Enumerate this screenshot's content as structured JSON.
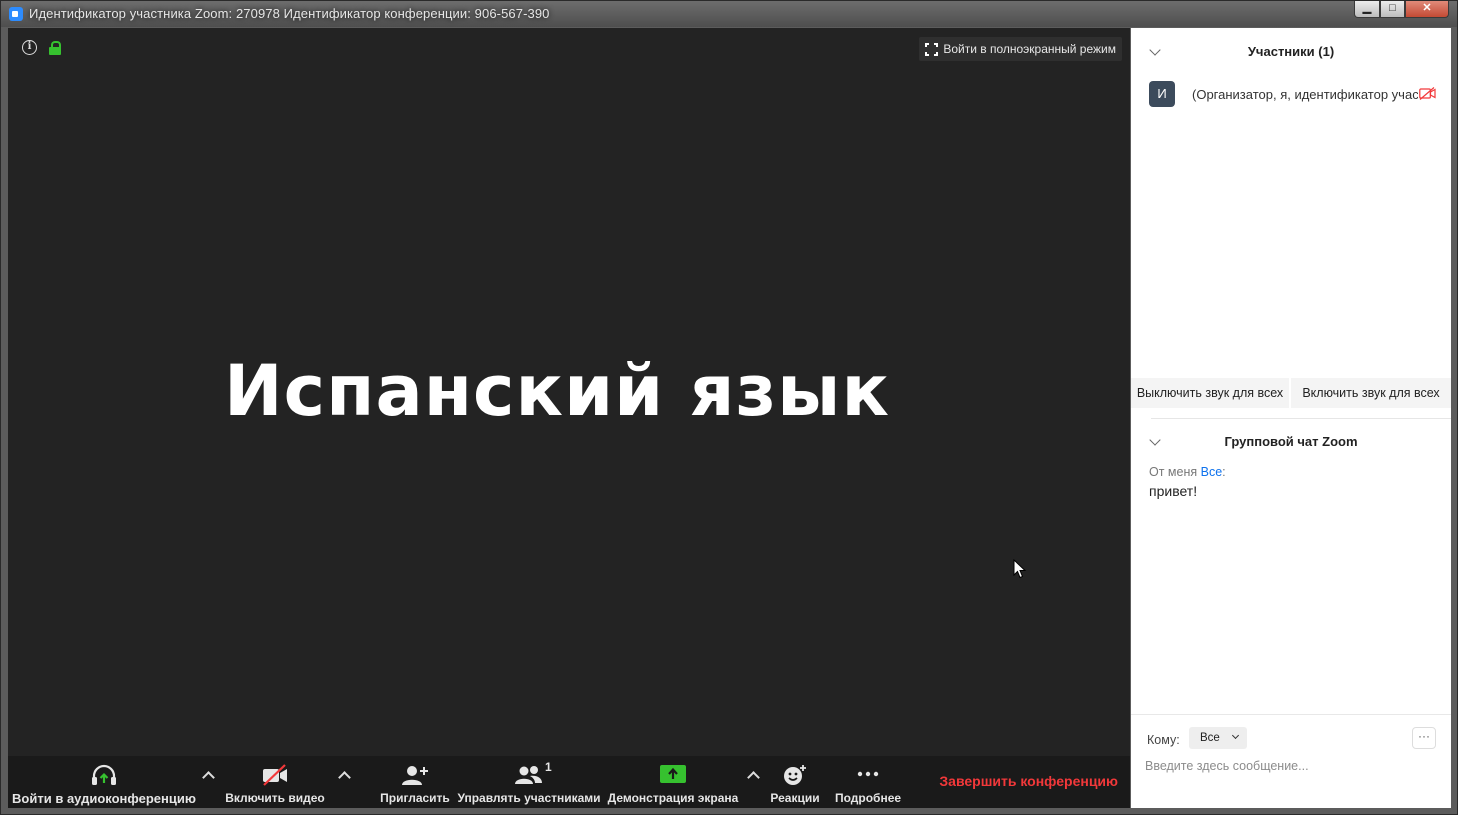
{
  "window": {
    "title": "Идентификатор участника Zoom: 270978   Идентификатор конференции: 906-567-390",
    "buttons": {
      "minimize": "▁",
      "maximize": "□",
      "close": "✕"
    }
  },
  "video": {
    "fullscreen_label": "Войти в полноэкранный режим",
    "main_title": "Испанский язык",
    "icons": [
      "info-icon",
      "lock-icon"
    ]
  },
  "toolbar": {
    "audio_label": "Войти в аудиоконференцию",
    "video_label": "Включить видео",
    "invite_label": "Пригласить",
    "participants_label": "Управлять участниками",
    "participants_count": "1",
    "share_label": "Демонстрация экрана",
    "reactions_label": "Реакции",
    "more_label": "Подробнее",
    "end_label": "Завершить конференцию",
    "accent_green": "#36c12f",
    "end_color": "#f2383a"
  },
  "participants_panel": {
    "title": "Участники (1)",
    "items": [
      {
        "avatar": "И",
        "name": "(Организатор, я, идентификатор участника"
      }
    ],
    "mute_all": "Выключить звук для всех",
    "unmute_all": "Включить звук для всех"
  },
  "chat_panel": {
    "title": "Групповой чат Zoom",
    "messages": [
      {
        "from": "От меня",
        "to": "Все",
        "text": "привет!"
      }
    ],
    "to_label": "Кому:",
    "to_value": "Все",
    "more": "···",
    "placeholder": "Введите здесь сообщение..."
  }
}
